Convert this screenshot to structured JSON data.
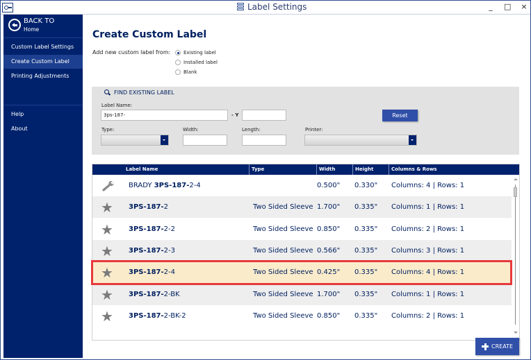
{
  "window": {
    "title": "Label Settings",
    "controls": {
      "minimize": "_",
      "maximize": "□",
      "close": "×"
    }
  },
  "sidebar": {
    "back": {
      "title": "BACK TO",
      "subtitle": "Home"
    },
    "items": [
      {
        "label": "Custom Label Settings",
        "active": false
      },
      {
        "label": "Create Custom Label",
        "active": true
      },
      {
        "label": "Printing Adjustments",
        "active": false
      }
    ],
    "footer_items": [
      {
        "label": "Help"
      },
      {
        "label": "About"
      }
    ]
  },
  "main": {
    "title": "Create Custom Label",
    "add_from_label": "Add new custom label from:",
    "sources": [
      {
        "label": "Existing label",
        "selected": true
      },
      {
        "label": "Installed label",
        "selected": false
      },
      {
        "label": "Blank",
        "selected": false
      }
    ],
    "find": {
      "heading": "FIND EXISTING LABEL",
      "label_name_label": "Label Name:",
      "label_name_value": "3ps-187-",
      "y_label": "- Y",
      "y_value": "",
      "reset_label": "Reset",
      "type_label": "Type:",
      "type_value": "",
      "width_label": "Width:",
      "width_value": "",
      "length_label": "Length:",
      "length_value": "",
      "printer_label": "Printer:",
      "printer_value": ""
    },
    "grid": {
      "columns": [
        "",
        "Label Name",
        "Type",
        "Width",
        "Height",
        "Columns & Rows"
      ],
      "rows": [
        {
          "icon": "wrench-icon",
          "prefix": "BRADY ",
          "match": "3PS-187-",
          "suffix": "2-4",
          "type": "",
          "width": "0.500\"",
          "height": "0.330\"",
          "colrows": "Columns: 4 | Rows: 1"
        },
        {
          "icon": "star-icon",
          "prefix": "",
          "match": "3PS-187-",
          "suffix": "2",
          "type": "Two Sided Sleeve",
          "width": "1.700\"",
          "height": "0.335\"",
          "colrows": "Columns: 1 | Rows: 1"
        },
        {
          "icon": "star-icon",
          "prefix": "",
          "match": "3PS-187-",
          "suffix": "2-2",
          "type": "Two Sided Sleeve",
          "width": "0.850\"",
          "height": "0.335\"",
          "colrows": "Columns: 2 | Rows: 1"
        },
        {
          "icon": "star-icon",
          "prefix": "",
          "match": "3PS-187-",
          "suffix": "2-3",
          "type": "Two Sided Sleeve",
          "width": "0.566\"",
          "height": "0.335\"",
          "colrows": "Columns: 3 | Rows: 1"
        },
        {
          "icon": "star-icon",
          "prefix": "",
          "match": "3PS-187-",
          "suffix": "2-4",
          "type": "Two Sided Sleeve",
          "width": "0.425\"",
          "height": "0.335\"",
          "colrows": "Columns: 4 | Rows: 1",
          "selected": true
        },
        {
          "icon": "star-icon",
          "prefix": "",
          "match": "3PS-187-",
          "suffix": "2-BK",
          "type": "Two Sided Sleeve",
          "width": "1.700\"",
          "height": "0.335\"",
          "colrows": "Columns: 1 | Rows: 1"
        },
        {
          "icon": "star-icon",
          "prefix": "",
          "match": "3PS-187-",
          "suffix": "2-BK-2",
          "type": "Two Sided Sleeve",
          "width": "0.850\"",
          "height": "0.335\"",
          "colrows": "Columns: 2 | Rows: 1"
        }
      ]
    },
    "create_label": "CREATE"
  },
  "colors": {
    "sidebar_bg": "#00226d",
    "accent_button": "#2f4fa8",
    "selected_row": "#faeccb",
    "highlight_border": "#e8393b"
  }
}
